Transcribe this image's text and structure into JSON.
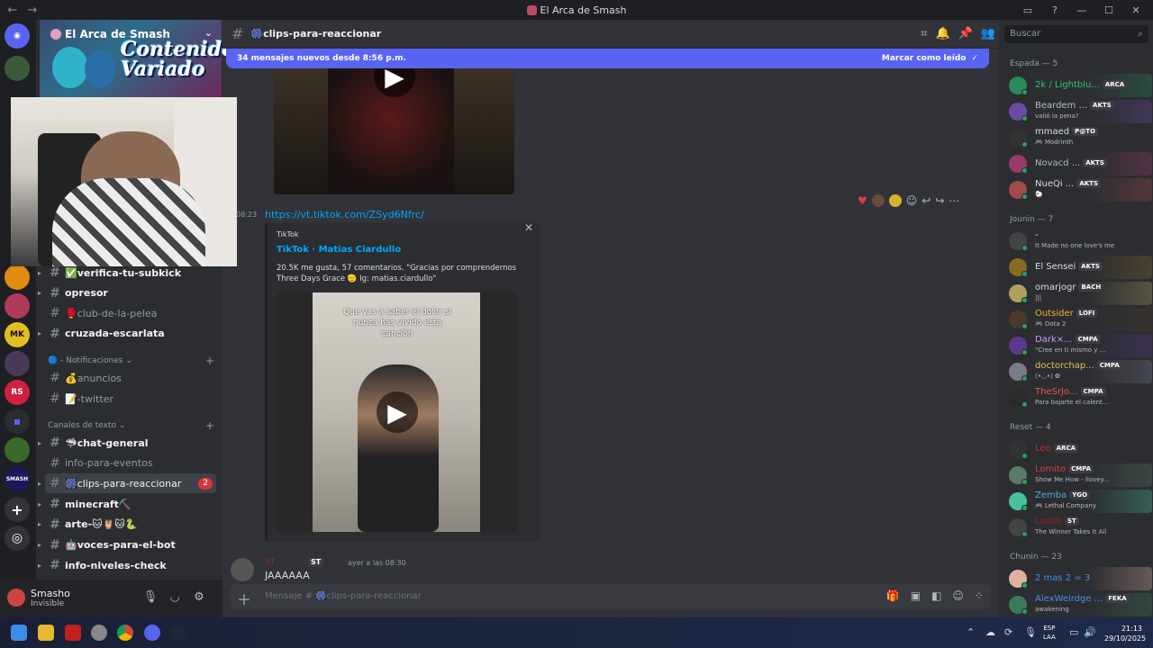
{
  "window": {
    "title": "El Arca de Smash"
  },
  "server": {
    "name": "El Arca de Smash",
    "banner_text": "Contenido Variado"
  },
  "channels": [
    {
      "label": "✅verifica-tu-subkick",
      "state": "unread",
      "arrow": true
    },
    {
      "label": "opresor",
      "state": "unread",
      "arrow": true
    },
    {
      "label": "🥊club-de-la-pelea",
      "state": "muted",
      "arrow": false
    },
    {
      "label": "cruzada-escarlata",
      "state": "unread",
      "arrow": true
    }
  ],
  "categories": {
    "notif": "🔵 - Notificaciones",
    "text": "Canales de texto"
  },
  "notif_channels": [
    {
      "label": "💰anuncios"
    },
    {
      "label": "📝-twitter"
    }
  ],
  "text_channels": [
    {
      "label": "🦈chat-general",
      "state": "unread"
    },
    {
      "label": "info-para-eventos",
      "state": "muted"
    },
    {
      "label": "🎆clips-para-reaccionar",
      "state": "active",
      "badge": "2"
    },
    {
      "label": "minecraft⛏️",
      "state": "unread"
    },
    {
      "label": "arte-🐱🦉🐱🐍",
      "state": "unread"
    },
    {
      "label": "🤖voces-para-el-bot",
      "state": "unread"
    },
    {
      "label": "info-niveles-check",
      "state": "unread"
    }
  ],
  "user": {
    "name": "Smasho",
    "status": "Invisible"
  },
  "header": {
    "channel": "🎆clips-para-reaccionar"
  },
  "newbar": {
    "text": "34 mensajes nuevos desde 8:56 p.m.",
    "action": "Marcar como leído"
  },
  "message1": {
    "time": "08:23",
    "link": "https://vt.tiktok.com/ZSyd6Nfrc/"
  },
  "embed": {
    "provider": "TikTok",
    "title": "TikTok · Matias Ciardullo",
    "description": "20.5K me gusta, 57 comentarios. \"Gracias por comprendernos Three Days Grace 🫡 Ig: matias.ciardullo\"",
    "caption": "Que vas a saber el dolor si nunca has vivido esta canción"
  },
  "message2": {
    "author": "ST",
    "tag": "ST",
    "time": "ayer a las 08:30",
    "text": "JAAAAAA"
  },
  "composer": {
    "placeholder": "Mensaje # 🎆clips-para-reaccionar"
  },
  "search": {
    "placeholder": "Buscar"
  },
  "member_groups": [
    {
      "label": "Espada — 5",
      "members": [
        {
          "name": "2k / Lightblu...",
          "tag": "ARCA",
          "sub": "",
          "color": "#2dc770",
          "av": "#2a8a5a"
        },
        {
          "name": "Beardem ...",
          "tag": "AKTS",
          "sub": "valió la pena?",
          "color": "#b5bac1",
          "av": "#6b4aa0"
        },
        {
          "name": "mmaed",
          "tag": "P@TO",
          "sub": "🎮 Modrinth",
          "color": "#dbdee1",
          "av": "#333"
        },
        {
          "name": "Novacd ...",
          "tag": "AKTS",
          "sub": "",
          "color": "#b5bac1",
          "av": "#9a3a6a"
        },
        {
          "name": "NueQi ...",
          "tag": "AKTS",
          "sub": "🐑",
          "color": "#dbdee1",
          "av": "#a04a4a"
        }
      ]
    },
    {
      "label": "Jounin — 7",
      "members": [
        {
          "name": "-",
          "tag": "",
          "sub": "It Made no one love's me",
          "color": "#dbdee1",
          "av": "#444"
        },
        {
          "name": "El Sensei",
          "tag": "AKTS",
          "sub": "",
          "color": "#dbdee1",
          "av": "#8a6a20"
        },
        {
          "name": "omarjogr",
          "tag": "BACH",
          "sub": "|||",
          "color": "#dbdee1",
          "av": "#b0a060"
        },
        {
          "name": "Outsider",
          "tag": "LOFI",
          "sub": "🎮 Dota 2",
          "color": "#f0b232",
          "av": "#4a3a2a"
        },
        {
          "name": "Dark×...",
          "tag": "CMPA",
          "sub": "\"Cree en ti mismo y ...",
          "color": "#c0a0ff",
          "av": "#5a3a8a"
        },
        {
          "name": "doctorchap...",
          "tag": "CMPA",
          "sub": "(•◡•) ✿",
          "color": "#e8c060",
          "av": "#7a7a8a"
        },
        {
          "name": "TheSrJo...",
          "tag": "CMPA",
          "sub": "Para bajarte el calent...",
          "color": "#e06040",
          "av": "#2a2a2a"
        }
      ]
    },
    {
      "label": "Reset — 4",
      "members": [
        {
          "name": "Leo",
          "tag": "ARCA",
          "sub": "",
          "color": "#c03030",
          "av": "#333"
        },
        {
          "name": "Lomito",
          "tag": "CMPA",
          "sub": "Show Me How - ilovey...",
          "color": "#d04040",
          "av": "#5a7a6a"
        },
        {
          "name": "Zemba",
          "tag": "YGO",
          "sub": "🎮 Lethal Company",
          "color": "#50b0d0",
          "av": "#4ac0a0"
        },
        {
          "name": "Lasith",
          "tag": "ST",
          "sub": "The Winner Takes It All",
          "color": "#a02020",
          "av": "#444"
        }
      ]
    },
    {
      "label": "Chunin — 23",
      "members": [
        {
          "name": "2 mas 2 = 3",
          "tag": "",
          "sub": "",
          "color": "#4a90e2",
          "av": "#e0b0a0"
        },
        {
          "name": "AlexWeirdge ...",
          "tag": "FEKA",
          "sub": "awakening",
          "color": "#4a90e2",
          "av": "#3a7a5a"
        }
      ]
    }
  ],
  "taskbar": {
    "lang_top": "ESP",
    "lang_bottom": "LAA",
    "time": "21:13",
    "date": "29/10/2025"
  }
}
